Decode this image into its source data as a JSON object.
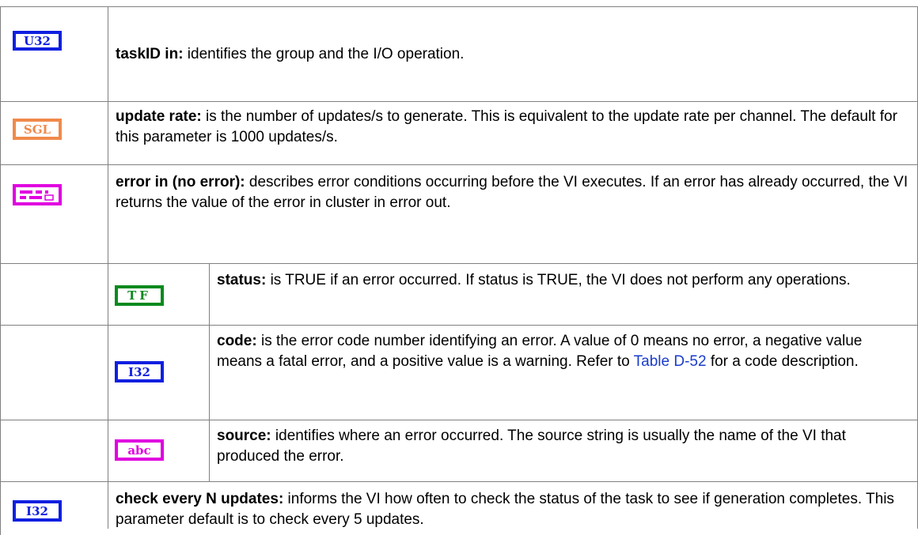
{
  "rows": [
    {
      "icon": {
        "name": "u32-icon",
        "text": "U32",
        "color": "#0f1fe0"
      },
      "term": "taskID in:",
      "desc": " identifies the group and the I/O operation."
    },
    {
      "icon": {
        "name": "sgl-icon",
        "text": "SGL",
        "color": "#f08a4b"
      },
      "term": "update rate:",
      "desc": " is the number of updates/s to generate. This is equivalent to the update rate per channel. The default for this parameter is 1000 updates/s."
    },
    {
      "icon": {
        "name": "error-cluster-icon",
        "text": "",
        "color": "#e000e0"
      },
      "term": "error in (no error):",
      "desc": " describes error conditions occurring before the VI executes. If an error has already occurred, the VI returns the value of the error in cluster in error out."
    },
    {
      "icon": {
        "name": "tf-icon",
        "text": "TF",
        "color": "#0a8a1e"
      },
      "term": "status:",
      "desc": " is TRUE if an error occurred.  If status is TRUE, the VI does not perform any operations."
    },
    {
      "icon": {
        "name": "i32-icon",
        "text": "I32",
        "color": "#0f1fe0"
      },
      "term": "code:",
      "desc_a": " is the error code number identifying an error.  A value of 0 means no error, a negative value means a fatal error, and a positive value is a warning. Refer to ",
      "link": "Table D-52",
      "desc_b": " for a code description."
    },
    {
      "icon": {
        "name": "abc-icon",
        "text": "abc",
        "color": "#e000e0"
      },
      "term": "source:",
      "desc": " identifies where an error occurred.  The source string is usually the name of the VI that produced the error."
    },
    {
      "icon": {
        "name": "i32-icon",
        "text": "I32",
        "color": "#0f1fe0"
      },
      "term": "check every N updates:",
      "desc": " informs the VI how often to check the status of the task to see if generation completes.  This parameter default is to check every 5 updates."
    }
  ]
}
